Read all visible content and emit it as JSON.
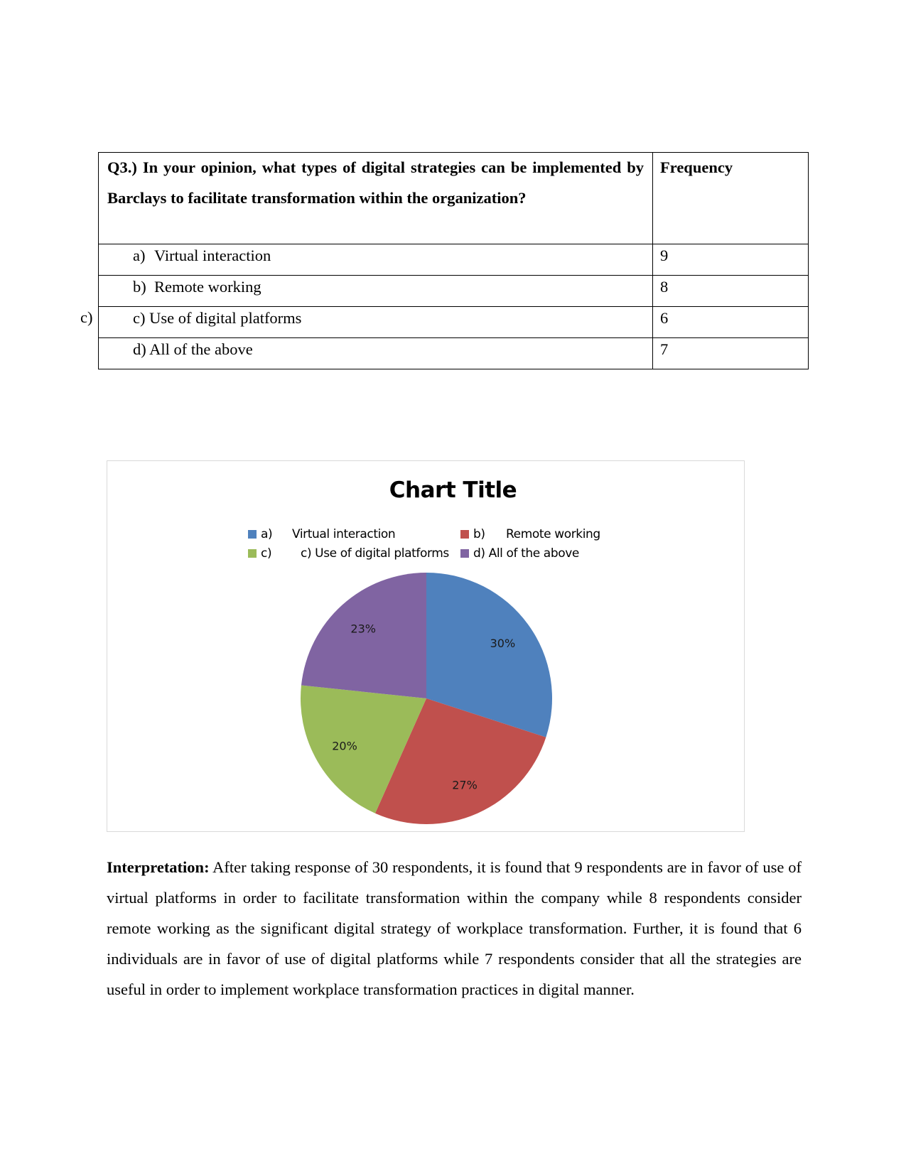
{
  "table": {
    "question": "Q3.) In your opinion, what types of digital strategies can be implemented  by Barclays to facilitate transformation within the organization?",
    "frequency_header": "Frequency",
    "rows": [
      {
        "marker": "a)",
        "label": "Virtual interaction",
        "frequency": "9"
      },
      {
        "marker": "b)",
        "label": "Remote working",
        "frequency": "8"
      },
      {
        "marker": "",
        "label": "c) Use of digital platforms",
        "frequency": "6"
      },
      {
        "marker": "",
        "label": "d) All of the above",
        "frequency": "7"
      }
    ],
    "stray_label": "c)"
  },
  "chart_data": {
    "type": "pie",
    "title": "Chart Title",
    "categories": [
      "a)      Virtual interaction",
      "b)      Remote working",
      "c)        c) Use of digital platforms",
      "d) All of the above"
    ],
    "legend": [
      {
        "key": "a)",
        "text": "Virtual interaction",
        "color": "#4f81bd"
      },
      {
        "key": "b)",
        "text": "Remote working",
        "color": "#c0504d"
      },
      {
        "key": "c)",
        "text": "c) Use of digital platforms",
        "color": "#9bbb59"
      },
      {
        "key": "",
        "text": "d) All of the above",
        "color": "#8064a2"
      }
    ],
    "values": [
      9,
      8,
      6,
      7
    ],
    "data_labels": [
      "30%",
      "27%",
      "20%",
      "23%"
    ],
    "colors": [
      "#4f81bd",
      "#c0504d",
      "#9bbb59",
      "#8064a2"
    ],
    "legend_position": "top",
    "start_angle": "12 o'clock, clockwise"
  },
  "interpretation": {
    "lead": "Interpretation:",
    "text": " After taking response of 30 respondents, it is found that 9 respondents are in favor of use of virtual platforms in order to facilitate transformation within the company while 8 respondents consider remote working as the significant digital strategy of workplace transformation. Further, it is found that 6 individuals are in favor of use of digital platforms while 7 respondents consider that all the strategies are useful in order to implement workplace transformation practices in digital manner."
  }
}
